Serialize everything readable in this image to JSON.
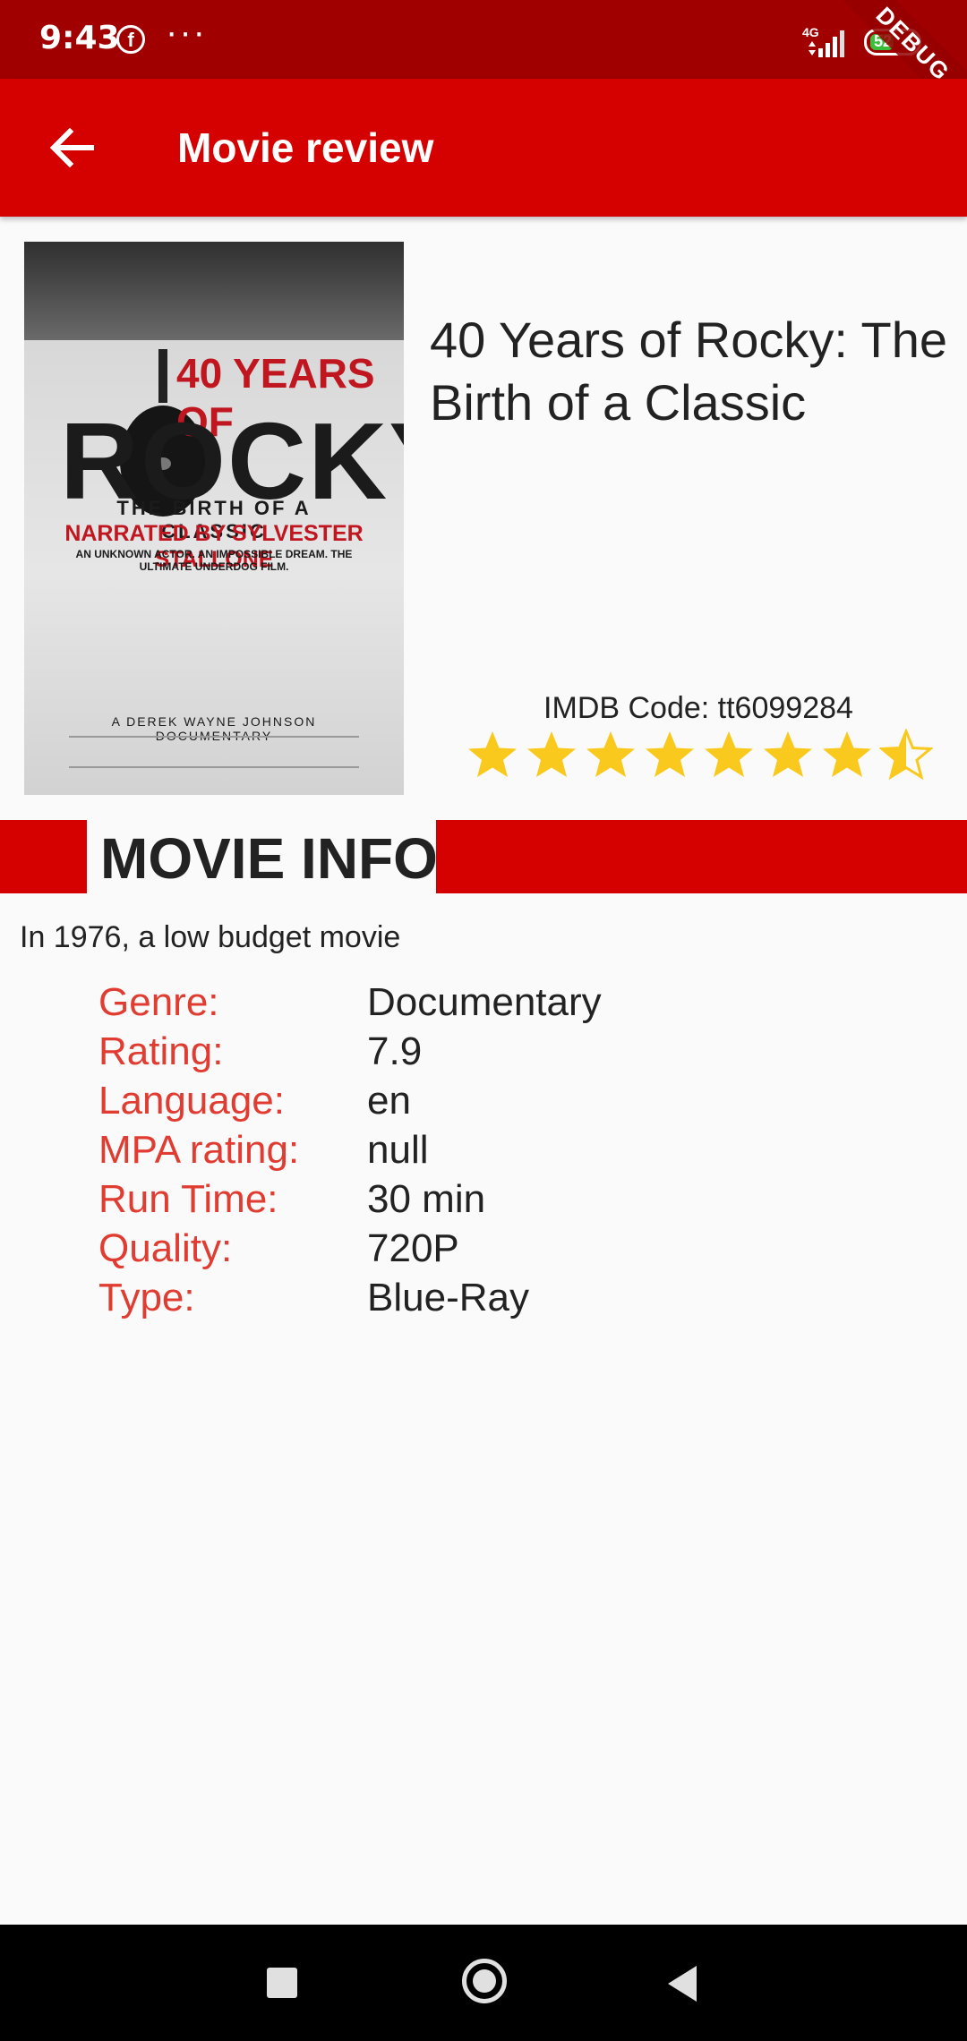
{
  "status_bar": {
    "time": "9:43",
    "network": "4G",
    "battery": "52",
    "debug_banner": "DEBUG"
  },
  "app_bar": {
    "title": "Movie review",
    "back_icon": "arrow-back-icon"
  },
  "movie": {
    "title": "40 Years of Rocky: The Birth of a Classic",
    "imdb_code": "IMDB Code: tt6099284",
    "stars_filled": 7,
    "stars_half": 1,
    "stars_total": 8,
    "star_color": "#f9c91e",
    "poster": {
      "line1": "40 YEARS OF",
      "line2": "ROCKY",
      "line3": "THE BIRTH OF A CLASSIC",
      "line4": "NARRATED BY SYLVESTER STALLONE",
      "line5": "AN UNKNOWN ACTOR. AN IMPOSSIBLE DREAM. THE ULTIMATE UNDERDOG FILM.",
      "credit": "A DEREK WAYNE JOHNSON DOCUMENTARY"
    }
  },
  "section": {
    "title": "MOVIE INFO"
  },
  "description": "In 1976, a low budget movie",
  "info": [
    {
      "key": "Genre:",
      "value": "Documentary"
    },
    {
      "key": "Rating:",
      "value": "7.9"
    },
    {
      "key": "Language:",
      "value": "en"
    },
    {
      "key": "MPA rating:",
      "value": "null"
    },
    {
      "key": "Run Time:",
      "value": "30 min"
    },
    {
      "key": "Quality:",
      "value": "720P"
    },
    {
      "key": "Type:",
      "value": "Blue-Ray"
    }
  ],
  "colors": {
    "app_bar": "#d50000",
    "status_bar": "#a00000",
    "label": "#e03c31"
  }
}
